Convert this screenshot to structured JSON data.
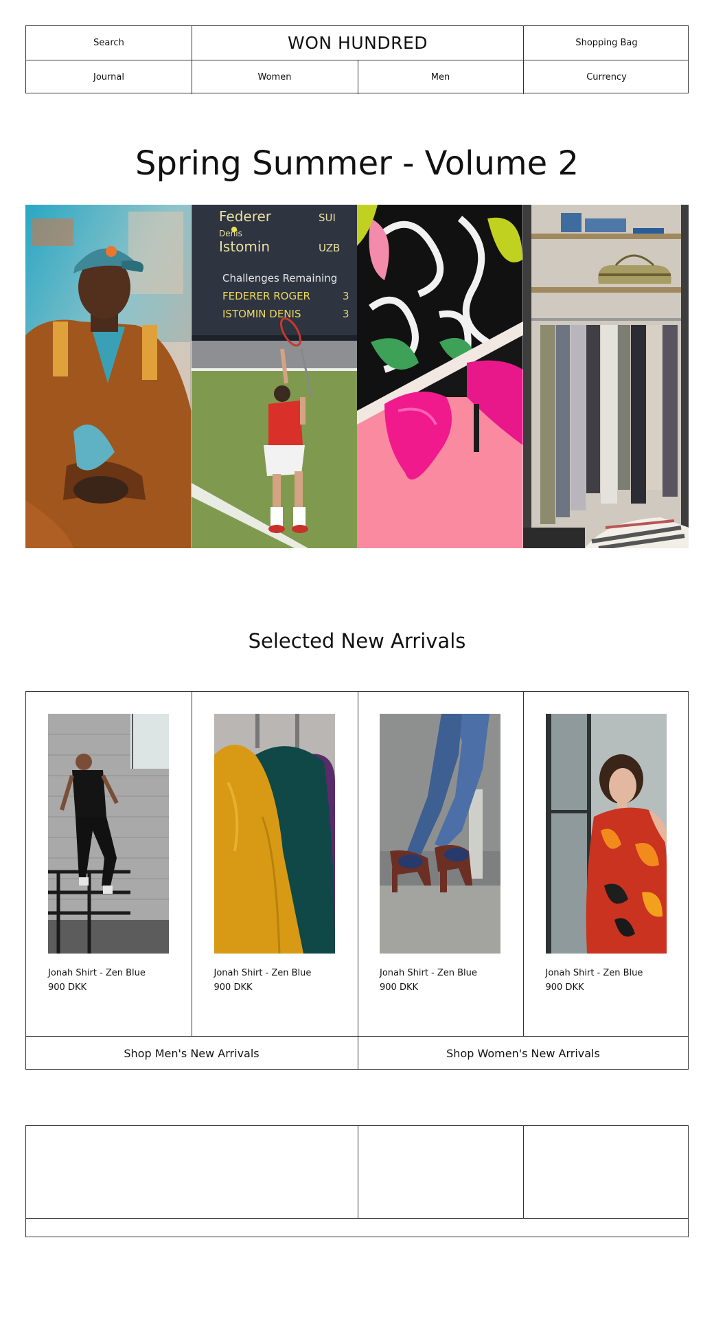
{
  "header": {
    "search_label": "Search",
    "brand": "WON HUNDRED",
    "bag_label": "Shopping Bag",
    "nav": [
      {
        "label": "Journal"
      },
      {
        "label": "Women"
      },
      {
        "label": "Men"
      },
      {
        "label": "Currency"
      }
    ]
  },
  "hero": {
    "title": "Spring Summer - Volume 2",
    "scoreboard": {
      "player1": "Federer",
      "country1": "SUI",
      "first_name2": "Denis",
      "player2": "Istomin",
      "country2": "UZB",
      "challenges_label": "Challenges Remaining",
      "row1_name": "FEDERER ROGER",
      "row1_value": "3",
      "row2_name": "ISTOMIN DENIS",
      "row2_value": "3"
    },
    "images": [
      "man-cap-photo",
      "tennis-photo",
      "pink-heels-photo",
      "clothing-rack-photo"
    ]
  },
  "arrivals": {
    "title": "Selected New Arrivals",
    "products": [
      {
        "name": "Jonah Shirt - Zen Blue",
        "price": "900 DKK"
      },
      {
        "name": "Jonah Shirt - Zen Blue",
        "price": "900 DKK"
      },
      {
        "name": "Jonah Shirt - Zen Blue",
        "price": "900 DKK"
      },
      {
        "name": "Jonah Shirt - Zen Blue",
        "price": "900 DKK"
      }
    ],
    "shop_men": "Shop Men's New Arrivals",
    "shop_women": "Shop Women's New Arrivals"
  }
}
